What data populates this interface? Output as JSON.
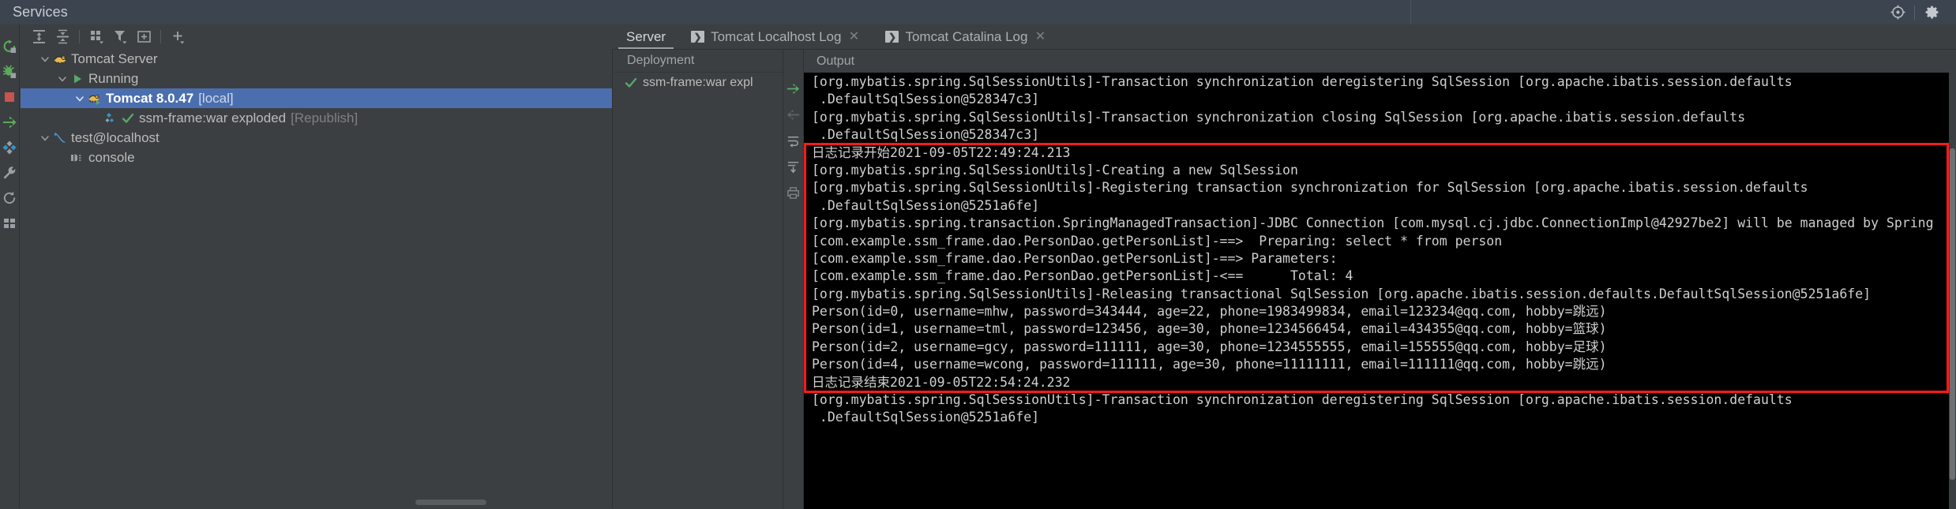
{
  "window": {
    "title": "Services",
    "titlebar_icons": [
      {
        "name": "locate-icon",
        "glyph": "locate"
      },
      {
        "name": "gear-icon",
        "glyph": "gear"
      }
    ]
  },
  "left_strip": {
    "items": [
      {
        "name": "rerun-icon",
        "glyph": "rerun",
        "title": "Rerun"
      },
      {
        "name": "debug-icon",
        "glyph": "debug",
        "title": "Debug"
      },
      {
        "name": "stop-icon",
        "glyph": "stop",
        "title": "Stop"
      },
      {
        "name": "redeploy-icon",
        "glyph": "redeploy",
        "title": "Redeploy"
      },
      {
        "name": "artifacts-icon",
        "glyph": "diamond",
        "title": "Artifacts"
      },
      {
        "name": "settings-wrench-icon",
        "glyph": "wrench",
        "title": "Edit Configuration"
      },
      {
        "name": "refresh-icon",
        "glyph": "refresh",
        "title": "Refresh"
      },
      {
        "name": "grid-icon",
        "glyph": "grid",
        "title": "Layout"
      }
    ]
  },
  "tree_toolbar": {
    "items": [
      {
        "name": "expand-all-icon",
        "glyph": "expand-all"
      },
      {
        "name": "collapse-all-icon",
        "glyph": "collapse-all"
      },
      {
        "name": "group-by-icon",
        "glyph": "group-by"
      },
      {
        "name": "filter-icon",
        "glyph": "filter"
      },
      {
        "name": "add-tab-icon",
        "glyph": "add-frame"
      },
      {
        "name": "add-icon",
        "glyph": "plus"
      }
    ]
  },
  "tree": {
    "nodes": [
      {
        "name": "tree-node-tomcat-server",
        "label": "Tomcat Server",
        "suffix": "",
        "indent": 0,
        "chevron": "down",
        "icon": "tomcat-icon",
        "selected": false,
        "bold": false
      },
      {
        "name": "tree-node-running",
        "label": "Running",
        "suffix": "",
        "indent": 1,
        "chevron": "down",
        "icon": "run-green-icon",
        "selected": false,
        "bold": false
      },
      {
        "name": "tree-node-tomcat-8047-local",
        "label": "Tomcat 8.0.47",
        "suffix": "[local]",
        "indent": 2,
        "chevron": "down",
        "icon": "tomcat-run-icon",
        "selected": true,
        "bold": true
      },
      {
        "name": "tree-node-ssm-frame-war-exploded",
        "label": "ssm-frame:war exploded",
        "suffix": "[Republish]",
        "indent": 3,
        "chevron": "none",
        "icon": "artifact-ok-icon",
        "selected": false,
        "bold": false
      },
      {
        "name": "tree-node-test-localhost",
        "label": "test@localhost",
        "suffix": "",
        "indent": 0,
        "chevron": "down",
        "icon": "mysql-dolphin-icon",
        "selected": false,
        "bold": false
      },
      {
        "name": "tree-node-console",
        "label": "console",
        "suffix": "",
        "indent": 1,
        "chevron": "none",
        "icon": "console-icon",
        "selected": false,
        "bold": false
      }
    ]
  },
  "tabs": [
    {
      "name": "tab-server",
      "label": "Server",
      "active": true,
      "has_icon": false,
      "closable": false
    },
    {
      "name": "tab-tomcat-localhost-log",
      "label": "Tomcat Localhost Log",
      "active": false,
      "has_icon": true,
      "closable": true
    },
    {
      "name": "tab-tomcat-catalina-log",
      "label": "Tomcat Catalina Log",
      "active": false,
      "has_icon": true,
      "closable": true
    }
  ],
  "deployment": {
    "header": "Deployment",
    "items": [
      {
        "name": "deployment-item-ssm-frame",
        "label": "ssm-frame:war expl",
        "status": "ok"
      }
    ],
    "actions": [
      {
        "name": "deploy-icon",
        "glyph": "redeploy",
        "enabled": true
      },
      {
        "name": "undeploy-icon",
        "glyph": "undeploy",
        "enabled": false
      }
    ]
  },
  "mini_toolbar": {
    "items": [
      {
        "name": "up-arrow-icon",
        "glyph": "arrow-up"
      },
      {
        "name": "down-arrow-icon",
        "glyph": "arrow-down"
      },
      {
        "name": "soft-wrap-icon",
        "glyph": "wrap"
      },
      {
        "name": "scroll-to-end-icon",
        "glyph": "scroll-end"
      },
      {
        "name": "print-icon",
        "glyph": "print"
      }
    ]
  },
  "output": {
    "header": "Output",
    "highlight_color": "#ff1a1a",
    "lines": [
      {
        "text": "[org.mybatis.spring.SqlSessionUtils]-Transaction synchronization deregistering SqlSession [org.apache.ibatis.session.defaults",
        "highlighted": false,
        "clipped_top": true
      },
      {
        "text": " .DefaultSqlSession@528347c3]",
        "highlighted": false
      },
      {
        "text": "[org.mybatis.spring.SqlSessionUtils]-Transaction synchronization closing SqlSession [org.apache.ibatis.session.defaults",
        "highlighted": false
      },
      {
        "text": " .DefaultSqlSession@528347c3]",
        "highlighted": false
      },
      {
        "text": "日志记录开始2021-09-05T22:49:24.213",
        "highlighted": true
      },
      {
        "text": "[org.mybatis.spring.SqlSessionUtils]-Creating a new SqlSession",
        "highlighted": true
      },
      {
        "text": "[org.mybatis.spring.SqlSessionUtils]-Registering transaction synchronization for SqlSession [org.apache.ibatis.session.defaults",
        "highlighted": true
      },
      {
        "text": " .DefaultSqlSession@5251a6fe]",
        "highlighted": true
      },
      {
        "text": "[org.mybatis.spring.transaction.SpringManagedTransaction]-JDBC Connection [com.mysql.cj.jdbc.ConnectionImpl@42927be2] will be managed by Spring",
        "highlighted": true
      },
      {
        "text": "[com.example.ssm_frame.dao.PersonDao.getPersonList]-==>  Preparing: select * from person",
        "highlighted": true
      },
      {
        "text": "[com.example.ssm_frame.dao.PersonDao.getPersonList]-==> Parameters:",
        "highlighted": true
      },
      {
        "text": "[com.example.ssm_frame.dao.PersonDao.getPersonList]-<==      Total: 4",
        "highlighted": true
      },
      {
        "text": "[org.mybatis.spring.SqlSessionUtils]-Releasing transactional SqlSession [org.apache.ibatis.session.defaults.DefaultSqlSession@5251a6fe]",
        "highlighted": true
      },
      {
        "text": "Person(id=0, username=mhw, password=343444, age=22, phone=1983499834, email=123234@qq.com, hobby=跳远)",
        "highlighted": true
      },
      {
        "text": "Person(id=1, username=tml, password=123456, age=30, phone=1234566454, email=434355@qq.com, hobby=篮球)",
        "highlighted": true
      },
      {
        "text": "Person(id=2, username=gcy, password=111111, age=30, phone=1234555555, email=155555@qq.com, hobby=足球)",
        "highlighted": true
      },
      {
        "text": "Person(id=4, username=wcong, password=111111, age=30, phone=11111111, email=111111@qq.com, hobby=跳远)",
        "highlighted": true
      },
      {
        "text": "日志记录结束2021-09-05T22:54:24.232",
        "highlighted": true
      },
      {
        "text": "[org.mybatis.spring.SqlSessionUtils]-Transaction synchronization deregistering SqlSession [org.apache.ibatis.session.defaults",
        "highlighted": false
      },
      {
        "text": " .DefaultSqlSession@5251a6fe]",
        "highlighted": false
      }
    ]
  }
}
